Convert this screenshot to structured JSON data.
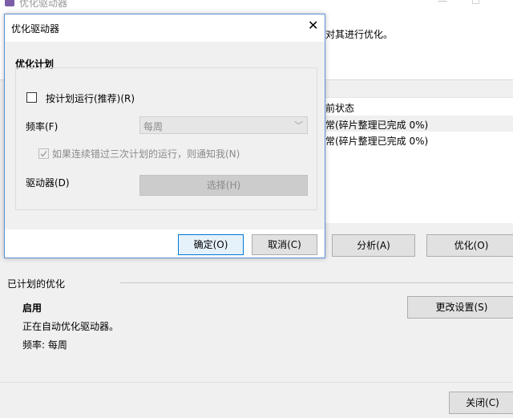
{
  "window": {
    "title": "优化驱动器",
    "description": "对其进行优化。",
    "controls": {
      "minimize": "—",
      "maximize": "☐",
      "close": "✕"
    }
  },
  "drive_list": {
    "column_header": "前状态",
    "rows": [
      {
        "status": "常(碎片整理已完成 0%)"
      },
      {
        "status": "常(碎片整理已完成 0%)"
      }
    ]
  },
  "actions": {
    "analyze": "分析(A)",
    "optimize": "优化(O)"
  },
  "scheduled": {
    "header": "已计划的优化",
    "state": "启用",
    "desc": "正在自动优化驱动器。",
    "frequency": "频率: 每周",
    "change_settings": "更改设置(S)"
  },
  "footer": {
    "close": "关闭(C)"
  },
  "dialog": {
    "title": "优化驱动器",
    "close_glyph": "✕",
    "section": "优化计划",
    "schedule_checkbox": "按计划运行(推荐)(R)",
    "schedule_checked": false,
    "frequency_label": "频率(F)",
    "frequency_value": "每周",
    "notify_label": "如果连续错过三次计划的运行，则通知我(N)",
    "notify_checked": true,
    "drives_label": "驱动器(D)",
    "choose": "选择(H)",
    "ok": "确定(O)",
    "cancel": "取消(C)"
  },
  "colors": {
    "accent": "#0078d7",
    "selected_row": "#f0f0f0",
    "dialog_border": "#5b8fd6"
  }
}
